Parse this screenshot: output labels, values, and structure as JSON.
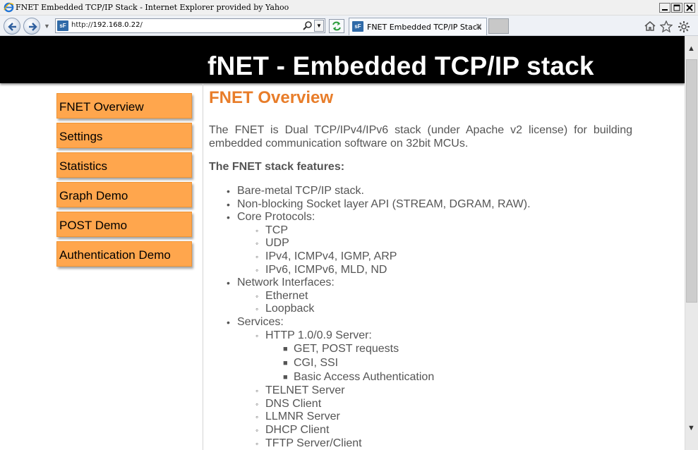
{
  "window": {
    "title": "FNET Embedded TCP/IP Stack - Internet Explorer provided by Yahoo"
  },
  "navbar": {
    "address_scheme": "http://",
    "address_host": "192.168.0.22",
    "address_path": "/",
    "site_icon_text": "sF",
    "tab_label": "FNET Embedded TCP/IP Stack",
    "tab_close": "✕"
  },
  "page": {
    "banner_title": "fNET - Embedded TCP/IP stack",
    "menu": [
      {
        "label": "FNET Overview"
      },
      {
        "label": "Settings"
      },
      {
        "label": "Statistics"
      },
      {
        "label": "Graph Demo"
      },
      {
        "label": "POST Demo"
      },
      {
        "label": "Authentication Demo"
      }
    ],
    "heading": "FNET Overview",
    "intro": "The FNET is Dual TCP/IPv4/IPv6 stack (under Apache v2 license) for building embedded communication software on 32bit MCUs.",
    "features_heading": "The FNET stack features:",
    "features": [
      {
        "level": 1,
        "text": "Bare-metal TCP/IP stack."
      },
      {
        "level": 1,
        "text": "Non-blocking Socket layer API (STREAM, DGRAM, RAW)."
      },
      {
        "level": 1,
        "text": "Core Protocols:"
      },
      {
        "level": 2,
        "text": "TCP"
      },
      {
        "level": 2,
        "text": "UDP"
      },
      {
        "level": 2,
        "text": "IPv4, ICMPv4, IGMP, ARP"
      },
      {
        "level": 2,
        "text": "IPv6, ICMPv6, MLD, ND"
      },
      {
        "level": 1,
        "text": "Network Interfaces:"
      },
      {
        "level": 2,
        "text": "Ethernet"
      },
      {
        "level": 2,
        "text": "Loopback"
      },
      {
        "level": 1,
        "text": "Services:"
      },
      {
        "level": 2,
        "text": "HTTP 1.0/0.9 Server:"
      },
      {
        "level": 3,
        "text": "GET, POST requests"
      },
      {
        "level": 3,
        "text": "CGI, SSI"
      },
      {
        "level": 3,
        "text": "Basic Access Authentication"
      },
      {
        "level": 2,
        "text": "TELNET Server"
      },
      {
        "level": 2,
        "text": "DNS Client"
      },
      {
        "level": 2,
        "text": "LLMNR Server"
      },
      {
        "level": 2,
        "text": "DHCP Client"
      },
      {
        "level": 2,
        "text": "TFTP Server/Client"
      }
    ]
  },
  "colors": {
    "menu_button": "#ffa64d",
    "heading": "#e87d2a",
    "banner": "#000000"
  },
  "icons": [
    "ie-logo-icon",
    "back-arrow-icon",
    "forward-arrow-icon",
    "search-icon",
    "refresh-icon",
    "home-icon",
    "favorites-star-icon",
    "gear-icon"
  ]
}
